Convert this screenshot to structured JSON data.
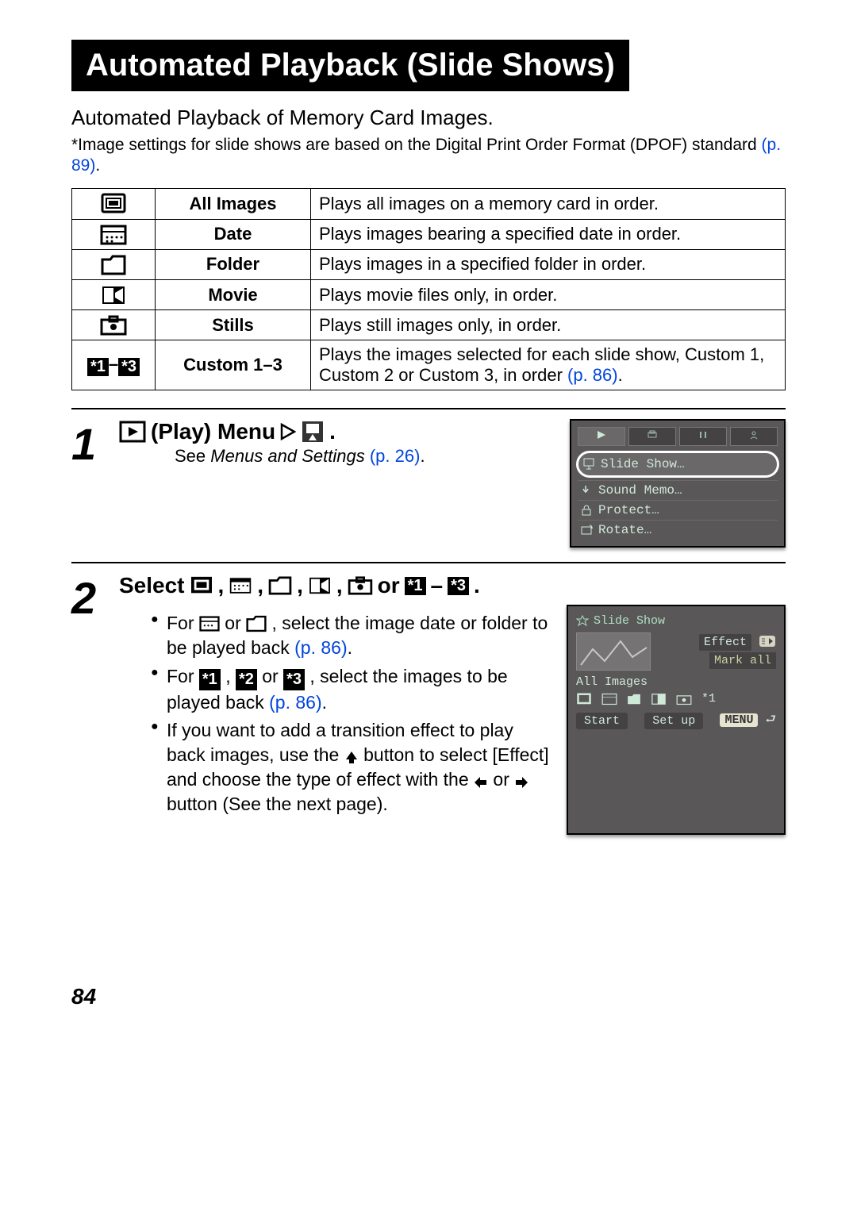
{
  "title": "Automated Playback (Slide Shows)",
  "subtitle": "Automated Playback of Memory Card Images.",
  "footnote_prefix": "*Image settings for slide shows are based on the Digital Print Order Format (DPOF) standard ",
  "footnote_ref": "(p. 89)",
  "footnote_period": ".",
  "table": {
    "rows": [
      {
        "name": "All Images",
        "desc": "Plays all images on a memory card in order."
      },
      {
        "name": "Date",
        "desc": "Plays images bearing a specified date in order."
      },
      {
        "name": "Folder",
        "desc": "Plays images in a specified folder in order."
      },
      {
        "name": "Movie",
        "desc": "Plays movie files only, in order."
      },
      {
        "name": "Stills",
        "desc": "Plays still images only, in order."
      },
      {
        "name": "Custom 1–3",
        "desc_prefix": "Plays the images selected for each slide show, Custom 1, Custom 2 or Custom 3, in order ",
        "desc_ref": "(p. 86)",
        "desc_period": "."
      }
    ]
  },
  "step1": {
    "num": "1",
    "head_play": "(Play) Menu",
    "head_period": ".",
    "sub_prefix": "See ",
    "sub_em": "Menus and Settings ",
    "sub_ref": "(p. 26)",
    "sub_period": ".",
    "screenshot": {
      "items": [
        "Slide Show…",
        "Sound Memo…",
        "Protect…",
        "Rotate…"
      ]
    }
  },
  "step2": {
    "num": "2",
    "head_select": "Select ",
    "head_or": " or ",
    "head_period": ".",
    "b1_a": "For ",
    "b1_b": " or ",
    "b1_c": ", select the image date or folder to be played back ",
    "b1_ref": "(p. 86)",
    "b1_period": ".",
    "b2_a": "For ",
    "b2_b": ", ",
    "b2_c": " or ",
    "b2_d": ", select the images to be played back ",
    "b2_ref": "(p. 86)",
    "b2_period": ".",
    "b3_a": "If you want to add a transition effect to play back images, use the ",
    "b3_b": " button to select [Effect] and choose the type of effect with the ",
    "b3_c": " or ",
    "b3_d": " button (See the next page).",
    "screenshot": {
      "title": "Slide Show",
      "effect": "Effect",
      "markall": "Mark all",
      "allimg": "All Images",
      "start": "Start",
      "setup": "Set up",
      "menu": "MENU",
      "star1": "*1"
    }
  },
  "page_number": "84",
  "comma": ", ",
  "dash": "–"
}
